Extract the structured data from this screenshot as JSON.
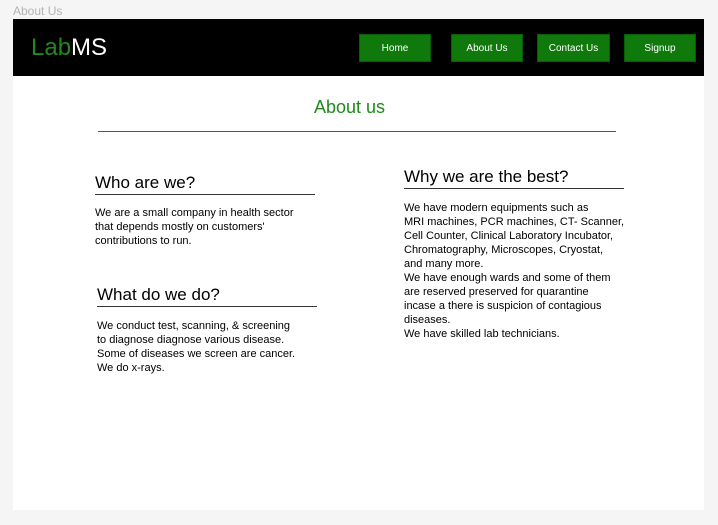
{
  "frame": {
    "label": "About Us"
  },
  "navbar": {
    "logo_lab": "Lab",
    "logo_ms": "MS",
    "links": [
      "Home",
      "About Us",
      "Contact Us",
      "Signup"
    ]
  },
  "page_title": "About us",
  "sections": {
    "who": {
      "heading": "Who are we?",
      "body": "We are a small company in health sector\nthat depends mostly on customers'\ncontributions to run."
    },
    "what": {
      "heading": "What do we do?",
      "body": "We conduct test, scanning, & screening\nto diagnose diagnose various disease.\nSome of diseases we screen are cancer.\nWe do x-rays."
    },
    "why": {
      "heading": "Why we are the best?",
      "body": "We have modern equipments such as\nMRI machines, PCR machines, CT- Scanner,\nCell Counter, Clinical Laboratory Incubator,\nChromatography, Microscopes, Cryostat,\nand many more.\nWe have enough wards and some of them\nare reserved preserved for quarantine\nincase a there is suspicion of contagious\ndiseases.\nWe have skilled lab technicians."
    }
  },
  "colors": {
    "accent_green": "#1e8a1a",
    "button_green": "#0f7a0b",
    "navbar_bg": "#000000"
  }
}
